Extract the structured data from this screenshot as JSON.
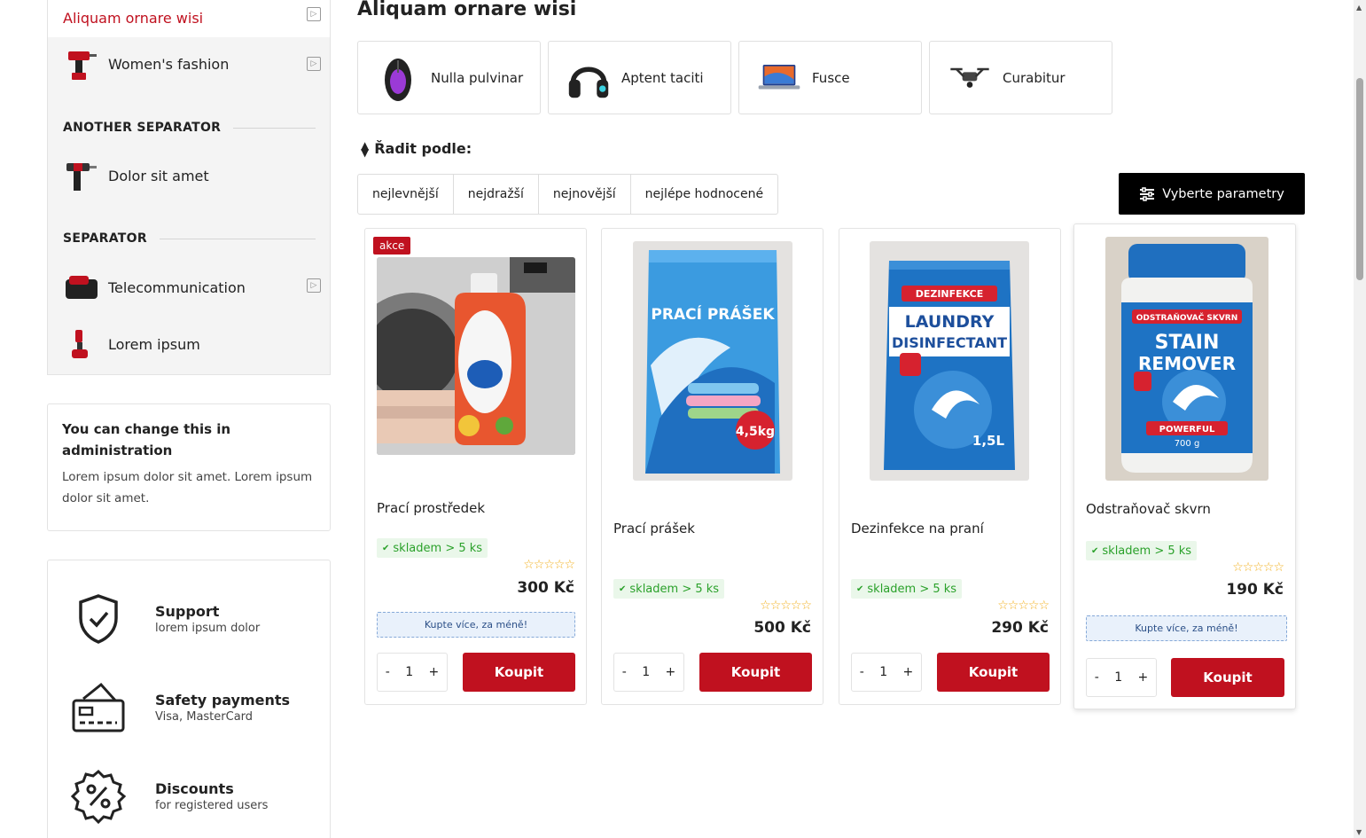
{
  "sidebar": {
    "categories": [
      {
        "label": "Aliquam ornare wisi",
        "active": true,
        "has_arrow": true
      },
      {
        "label": "Women's fashion",
        "icon": "drill-icon",
        "has_arrow": true
      },
      {
        "label": "Dolor sit amet",
        "icon": "hammer-drill-icon",
        "has_arrow": false
      },
      {
        "label": "Telecommunication",
        "icon": "battery-icon",
        "has_arrow": true
      },
      {
        "label": "Lorem ipsum",
        "icon": "chainsaw-icon",
        "has_arrow": false
      }
    ],
    "separators": [
      "ANOTHER SEPARATOR",
      "SEPARATOR"
    ],
    "info": {
      "title": "You can change this in administration",
      "text": "Lorem ipsum dolor sit amet. Lorem ipsum dolor sit amet."
    },
    "features": [
      {
        "title": "Support",
        "subtitle": "lorem ipsum dolor",
        "icon": "shield-check-icon"
      },
      {
        "title": "Safety payments",
        "subtitle": "Visa, MasterCard",
        "icon": "card-icon"
      },
      {
        "title": "Discounts",
        "subtitle": "for registered users",
        "icon": "discount-icon"
      }
    ]
  },
  "main": {
    "title": "Aliquam ornare wisi",
    "subcategories": [
      {
        "label": "Nulla pulvinar",
        "icon": "mouse-icon"
      },
      {
        "label": "Aptent taciti",
        "icon": "headphones-icon"
      },
      {
        "label": "Fusce",
        "icon": "laptop-icon"
      },
      {
        "label": "Curabitur",
        "icon": "drone-icon"
      }
    ],
    "sort": {
      "label": "Řadit podle:",
      "options": [
        "nejlevnější",
        "nejdražší",
        "nejnovější",
        "nejlépe hodnocené"
      ]
    },
    "filter_button": "Vyberte parametry",
    "products": [
      {
        "name": "Prací prostředek",
        "badge": "akce",
        "stock": "skladem > 5 ks",
        "price": "300 Kč",
        "promo": "Kupte více, za méně!",
        "qty": "1",
        "buy": "Koupit",
        "rating": 0,
        "stars": "☆☆☆☆☆"
      },
      {
        "name": "Prací prášek",
        "badge": "",
        "stock": "skladem > 5 ks",
        "price": "500 Kč",
        "promo": "",
        "qty": "1",
        "buy": "Koupit",
        "rating": 0,
        "stars": "☆☆☆☆☆",
        "image_text": [
          "PRACÍ PRÁŠEK",
          "4,5kg"
        ]
      },
      {
        "name": "Dezinfekce na praní",
        "badge": "",
        "stock": "skladem > 5 ks",
        "price": "290 Kč",
        "promo": "",
        "qty": "1",
        "buy": "Koupit",
        "rating": 0,
        "stars": "☆☆☆☆☆",
        "image_text": [
          "DEZINFEKCE",
          "LAUNDRY",
          "DISINFECTANT",
          "1,5L"
        ]
      },
      {
        "name": "Odstraňovač skvrn",
        "badge": "",
        "stock": "skladem > 5 ks",
        "price": "190 Kč",
        "promo": "Kupte více, za méně!",
        "qty": "1",
        "buy": "Koupit",
        "rating": 0,
        "stars": "☆☆☆☆☆",
        "image_text": [
          "ODSTRAŇOVAČ SKVRN",
          "STAIN",
          "REMOVER",
          "POWERFUL",
          "700 g"
        ]
      }
    ],
    "qty_minus": "-",
    "qty_plus": "+",
    "check": "✔",
    "arrow_glyph": "▷"
  },
  "colors": {
    "accent": "#c0111f",
    "stock_green": "#2aa12a",
    "star": "#f2b01e"
  }
}
